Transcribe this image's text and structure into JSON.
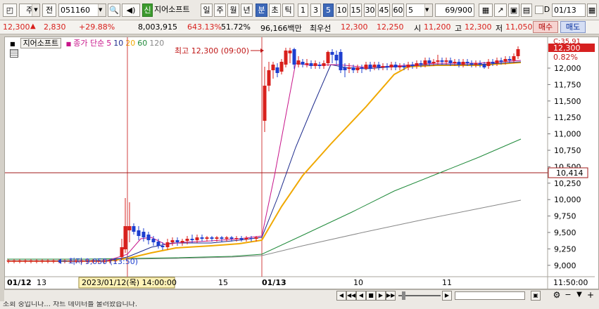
{
  "toolbar": {
    "market": "주",
    "jeon_label": "전",
    "code": "051160",
    "sin_label": "신",
    "stock_name": "지어소프트",
    "period_day": "일",
    "period_week": "주",
    "period_month": "월",
    "period_year": "년",
    "period_min": "분",
    "period_sec": "초",
    "period_tick": "틱",
    "intervals": [
      "1",
      "3",
      "5",
      "10",
      "15",
      "30",
      "45",
      "60"
    ],
    "selected_interval": "5",
    "interval_select": "5",
    "count_value": "69",
    "count_total": "/900",
    "d_label": "D",
    "date_value": "01/13"
  },
  "info": {
    "price": "12,300",
    "change": "2,830",
    "change_pct": "+29.88%",
    "volume": "8,003,915",
    "vol_ratio": "643.13%",
    "other_pct": "51.72%",
    "amount": "96,166백만",
    "best_label": "최우선",
    "best_ask": "12,300",
    "best_bid": "12,250",
    "open_label": "시",
    "open": "11,200",
    "high_label": "고",
    "high": "12,300",
    "low_label": "저",
    "low": "11,050",
    "buy_label": "매수",
    "sell_label": "매도"
  },
  "legend": {
    "name": "지어소프트",
    "series_label": "종가 단순",
    "ma": [
      "5",
      "10",
      "20",
      "60",
      "120"
    ]
  },
  "colors": {
    "up": "#d8201c",
    "down": "#1e3fd0",
    "ma5": "#c8158a",
    "ma10": "#1c2a8c",
    "ma20": "#f0a800",
    "ma60": "#1f8a3a",
    "ma120": "#888888",
    "hline": "#a01818"
  },
  "chart": {
    "max_label": "최고 12,300 (09:00)",
    "min_label": "최저 9,050 (13:50)",
    "c_label": "C:35.91",
    "last_price_tag": "12,300",
    "pct_tag": "0.82%",
    "line_value_tag": "10,414",
    "hline_value": 10414,
    "y_labels": [
      "12,000",
      "11,750",
      "11,500",
      "11,250",
      "11,000",
      "10,750",
      "10,500",
      "10,250",
      "10,000",
      "9,750",
      "9,500",
      "9,250",
      "9,000"
    ],
    "x_labels": [
      "01/12",
      "13",
      "15",
      "01/13",
      "10",
      "11"
    ],
    "cursor_label": "2023/01/12(목) 14:00:00",
    "time_label": "11:50:00"
  },
  "scroll": {
    "back_all": "◀◀",
    "back": "◀",
    "stop": "■",
    "fwd": "▶",
    "fwd_all": "▶▶"
  },
  "status": "조회 중입니다... 차트 데이터를 불러왔습니다."
}
